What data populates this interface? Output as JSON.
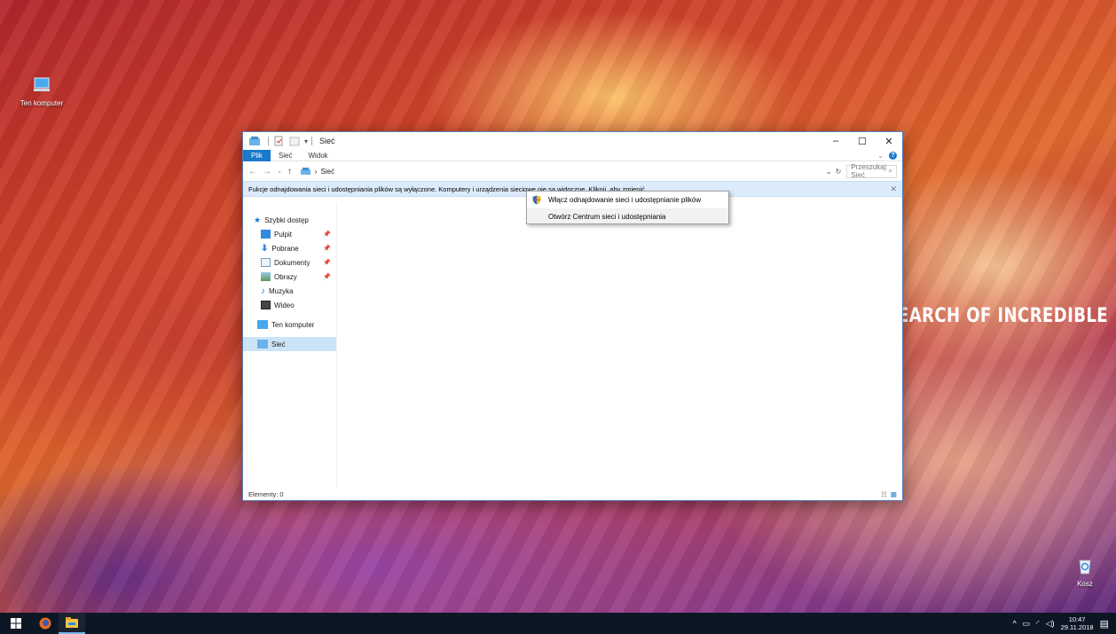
{
  "desktop": {
    "icons": [
      {
        "label": "Ten komputer",
        "icon": "computer-icon"
      },
      {
        "label": "Kosz",
        "icon": "recycle-bin-icon"
      }
    ],
    "wallpaper_text": "EARCH OF INCREDIBLE"
  },
  "window": {
    "title": "Sieć",
    "controls": {
      "minimize": "–",
      "maximize": "☐",
      "close": "✕"
    },
    "ribbon_tabs": [
      "Plik",
      "Sieć",
      "Widok"
    ],
    "address": {
      "back": "←",
      "forward": "→",
      "up": "↑",
      "separator": "›",
      "location": "Sieć"
    },
    "search_placeholder": "Przeszukaj: Sieć",
    "infobar_text": "Fukcje odnajdowania sieci i udostępniania plików są wyłączone. Komputery i urządzenia sieciowe nie są widoczne. Kliknij, aby zmienić...",
    "nav": {
      "quick_access": "Szybki dostęp",
      "items": [
        {
          "label": "Pulpit",
          "pinned": true
        },
        {
          "label": "Pobrane",
          "pinned": true
        },
        {
          "label": "Dokumenty",
          "pinned": true
        },
        {
          "label": "Obrazy",
          "pinned": true
        },
        {
          "label": "Muzyka",
          "pinned": false
        },
        {
          "label": "Wideo",
          "pinned": false
        }
      ],
      "this_pc": "Ten komputer",
      "network": "Sieć"
    },
    "status": "Elementy: 0"
  },
  "context_menu": {
    "items": [
      "Włącz odnajdowanie sieci i udostępnianie plików",
      "Otwórz Centrum sieci i udostępniania"
    ]
  },
  "taskbar": {
    "apps": [
      "start-icon",
      "firefox-icon",
      "file-explorer-icon"
    ],
    "time": "10:47",
    "date": "29.11.2018"
  },
  "colors": {
    "accent": "#1979ca",
    "infobar": "#dcebfb",
    "taskbar": "#0d1624"
  }
}
